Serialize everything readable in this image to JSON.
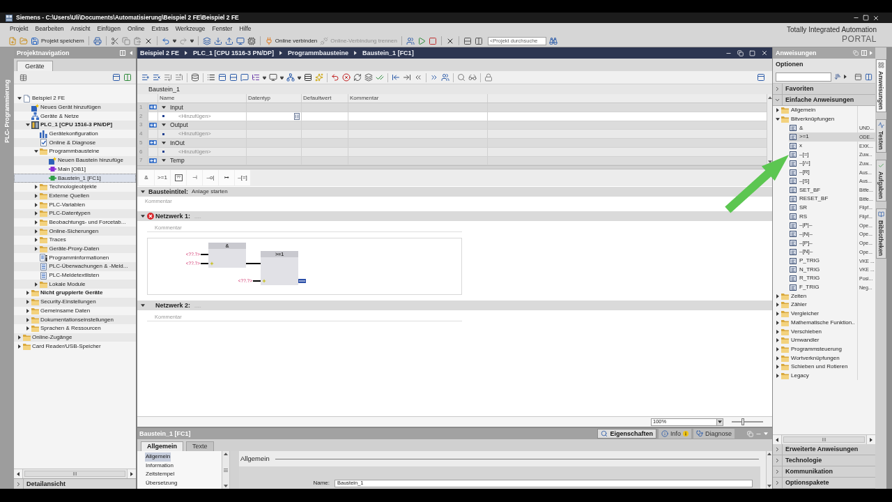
{
  "window": {
    "title": "Siemens - C:\\Users\\Uli\\Documents\\Automatisierung\\Beispiel 2 FE\\Beispiel 2 FE"
  },
  "menu": [
    "Projekt",
    "Bearbeiten",
    "Ansicht",
    "Einfügen",
    "Online",
    "Extras",
    "Werkzeuge",
    "Fenster",
    "Hilfe"
  ],
  "toolbar": {
    "save": {
      "label": "Projekt speichern"
    },
    "connect": {
      "label": "Online verbinden",
      "disabled": false
    },
    "disconnect": {
      "label": "Online-Verbindung trennen",
      "disabled": true
    },
    "search": {
      "placeholder": "<Projekt durchsuche"
    }
  },
  "brand": {
    "line_1": "Totally Integrated Automation",
    "line_2": "PORTAL"
  },
  "portal_strip": {
    "label": "PLC- Programmierung"
  },
  "project_navigation": {
    "title": "Projektnavigation",
    "tabs": [
      {
        "label": "Geräte",
        "selected": true
      }
    ],
    "tree": [
      {
        "label": "Beispiel 2 FE",
        "kind": "project",
        "expanded": true,
        "selected": false,
        "children": [
          {
            "label": "Neues Gerät hinzufügen",
            "kind": "add",
            "selected": false
          },
          {
            "label": "Geräte & Netze",
            "kind": "network",
            "selected": false
          },
          {
            "label": "PLC_1 [CPU 1516-3 PN/DP]",
            "kind": "device",
            "expanded": true,
            "selected": false,
            "children": [
              {
                "label": "Gerätekonfiguration",
                "kind": "config",
                "selected": false
              },
              {
                "label": "Online & Diagnose",
                "kind": "diagnose",
                "selected": false
              },
              {
                "label": "Programmbausteine",
                "kind": "folder",
                "expanded": true,
                "selected": false,
                "children": [
                  {
                    "label": "Neuen Baustein hinzufüge",
                    "kind": "add",
                    "selected": false
                  },
                  {
                    "label": "Main [OB1]",
                    "kind": "block",
                    "color": "#8b2fd6",
                    "selected": false
                  },
                  {
                    "label": "Baustein_1 [FC1]",
                    "kind": "block",
                    "color": "#2f9e46",
                    "selected": true
                  }
                ]
              },
              {
                "label": "Technologieobjekte",
                "kind": "folder",
                "expanded": false,
                "selected": false
              },
              {
                "label": "Externe Quellen",
                "kind": "folder",
                "expanded": false,
                "selected": false
              },
              {
                "label": "PLC-Variablen",
                "kind": "folder",
                "expanded": false,
                "selected": false
              },
              {
                "label": "PLC-Datentypen",
                "kind": "folder",
                "expanded": false,
                "selected": false
              },
              {
                "label": "Beobachtungs- und Forcetab...",
                "kind": "folder",
                "expanded": false,
                "selected": false
              },
              {
                "label": "Online-Sicherungen",
                "kind": "folder",
                "expanded": false,
                "selected": false
              },
              {
                "label": "Traces",
                "kind": "folder",
                "expanded": false,
                "selected": false
              },
              {
                "label": "Geräte-Proxy-Daten",
                "kind": "folder",
                "expanded": false,
                "selected": false
              },
              {
                "label": "Programminformationen",
                "kind": "info",
                "selected": false
              },
              {
                "label": "PLC-Überwachungen & -Meld...",
                "kind": "list",
                "selected": false
              },
              {
                "label": "PLC-Meldetextlisten",
                "kind": "list",
                "selected": false
              },
              {
                "label": "Lokale Module",
                "kind": "folder",
                "expanded": false,
                "selected": false
              }
            ]
          },
          {
            "label": "Nicht gruppierte Geräte",
            "kind": "device-folder",
            "expanded": false,
            "selected": false
          },
          {
            "label": "Security-Einstellungen",
            "kind": "folder",
            "expanded": false,
            "selected": false
          },
          {
            "label": "Gemeinsame Daten",
            "kind": "folder",
            "expanded": false,
            "selected": false
          },
          {
            "label": "Dokumentationseinstellungen",
            "kind": "folder",
            "expanded": false,
            "selected": false
          },
          {
            "label": "Sprachen & Ressourcen",
            "kind": "folder",
            "expanded": false,
            "selected": false
          }
        ]
      },
      {
        "label": "Online-Zugänge",
        "kind": "folder",
        "expanded": false,
        "selected": false
      },
      {
        "label": "Card Reader/USB-Speicher",
        "kind": "folder",
        "expanded": false,
        "selected": false
      }
    ],
    "detail_view": {
      "label": "Detailansicht",
      "expanded": false
    }
  },
  "editor": {
    "breadcrumb": [
      "Beispiel 2 FE",
      "PLC_1 [CPU 1516-3 PN/DP]",
      "Programmbausteine",
      "Baustein_1 [FC1]"
    ],
    "block_name": "Baustein_1",
    "interface": {
      "columns": [
        "Name",
        "Datentyp",
        "Defaultwert",
        "Kommentar"
      ],
      "rows": [
        {
          "number": "1",
          "kind": "section",
          "name": "Input",
          "expanded": true,
          "selected": false
        },
        {
          "number": "2",
          "kind": "add",
          "name": "<Hinzufügen>",
          "selected": true
        },
        {
          "number": "3",
          "kind": "section",
          "name": "Output",
          "expanded": true,
          "selected": false
        },
        {
          "number": "4",
          "kind": "add",
          "name": "<Hinzufügen>",
          "selected": false
        },
        {
          "number": "5",
          "kind": "section",
          "name": "InOut",
          "expanded": true,
          "selected": false
        },
        {
          "number": "6",
          "kind": "add",
          "name": "<Hinzufügen>",
          "selected": false
        },
        {
          "number": "7",
          "kind": "section",
          "name": "Temp",
          "expanded": true,
          "selected": false
        }
      ]
    },
    "lad_toolbar": [
      {
        "kind": "text",
        "label": "&"
      },
      {
        "kind": "text",
        "label": ">=1"
      },
      {
        "kind": "box",
        "label": "??"
      },
      {
        "kind": "text",
        "label": "⊣"
      },
      {
        "kind": "text",
        "label": "–o|"
      },
      {
        "kind": "text",
        "label": "↦"
      },
      {
        "kind": "text",
        "label": "–[=]"
      }
    ],
    "block_title": {
      "label": "Bausteintitel:",
      "value": "Anlage starten",
      "expanded": true,
      "comment": {
        "placeholder": "Kommentar"
      }
    },
    "networks": [
      {
        "label": "Netzwerk 1:",
        "title": ".....",
        "error": true,
        "expanded": true,
        "comment": {
          "placeholder": "Kommentar"
        },
        "diagram": {
          "gates": [
            {
              "label": "&",
              "inputs": [
                "<??.?>",
                "<??.?>"
              ]
            },
            {
              "label": ">=1",
              "inputs": [
                "<??.?>"
              ]
            }
          ]
        }
      },
      {
        "label": "Netzwerk 2:",
        "title": ".....",
        "error": false,
        "expanded": true,
        "comment": {
          "placeholder": "Kommentar"
        }
      }
    ],
    "zoom": {
      "value": "100%",
      "level": 0.35
    }
  },
  "inspector": {
    "title": "Baustein_1 [FC1]",
    "tabs": [
      {
        "label": "Eigenschaften",
        "kind": "properties",
        "selected": true,
        "notice": false
      },
      {
        "label": "Info",
        "kind": "info",
        "selected": false,
        "notice": true
      },
      {
        "label": "Diagnose",
        "kind": "diagnostics",
        "selected": false,
        "notice": false
      }
    ],
    "subtabs": [
      {
        "label": "Allgemein",
        "selected": true
      },
      {
        "label": "Texte",
        "selected": false
      }
    ],
    "nav": [
      {
        "label": "Allgemein",
        "selected": true
      },
      {
        "label": "Information",
        "selected": false
      },
      {
        "label": "Zeitstempel",
        "selected": false
      },
      {
        "label": "Übersetzung",
        "selected": false
      }
    ],
    "section_title": "Allgemein",
    "fields": [
      {
        "label": "Name:",
        "value": "Baustein_1"
      }
    ]
  },
  "instructions": {
    "title": "Anweisungen",
    "options_label": "Optionen",
    "sections": [
      {
        "label": "Favoriten",
        "expanded": false
      },
      {
        "label": "Einfache Anweisungen",
        "expanded": true,
        "tree": [
          {
            "label": "Allgemein",
            "kind": "folder",
            "expanded": false,
            "selected": false
          },
          {
            "label": "Bitverknüpfungen",
            "kind": "folder",
            "expanded": true,
            "selected": false,
            "children": [
              {
                "label": "&",
                "description": "UND...",
                "kind": "instruction",
                "selected": false
              },
              {
                "label": ">=1",
                "description": "ODE...",
                "kind": "instruction",
                "selected": true
              },
              {
                "label": "x",
                "description": "EXK...",
                "kind": "instruction",
                "selected": false
              },
              {
                "label": "–[=]",
                "description": "Zuw...",
                "kind": "instruction",
                "selected": false
              },
              {
                "label": "–[/=]",
                "description": "Zuw...",
                "kind": "instruction",
                "selected": false
              },
              {
                "label": "–[R]",
                "description": "Aus...",
                "kind": "instruction",
                "selected": false
              },
              {
                "label": "–[S]",
                "description": "Aus...",
                "kind": "instruction",
                "selected": false
              },
              {
                "label": "SET_BF",
                "description": "Bitfe...",
                "kind": "instruction",
                "selected": false
              },
              {
                "label": "RESET_BF",
                "description": "Bitfe...",
                "kind": "instruction",
                "selected": false
              },
              {
                "label": "SR",
                "description": "Flipf...",
                "kind": "instruction",
                "selected": false
              },
              {
                "label": "RS",
                "description": "Flipf...",
                "kind": "instruction",
                "selected": false
              },
              {
                "label": "–|P|–",
                "description": "Ope...",
                "kind": "instruction",
                "selected": false
              },
              {
                "label": "–|N|–",
                "description": "Ope...",
                "kind": "instruction",
                "selected": false
              },
              {
                "label": "–[P]–",
                "description": "Ope...",
                "kind": "instruction",
                "selected": false
              },
              {
                "label": "–[N]–",
                "description": "Ope...",
                "kind": "instruction",
                "selected": false
              },
              {
                "label": "P_TRIG",
                "description": "VKE ...",
                "kind": "instruction",
                "selected": false
              },
              {
                "label": "N_TRIG",
                "description": "VKE ...",
                "kind": "instruction",
                "selected": false
              },
              {
                "label": "R_TRIG",
                "description": "Posi...",
                "kind": "instruction",
                "selected": false
              },
              {
                "label": "F_TRIG",
                "description": "Neg...",
                "kind": "instruction",
                "selected": false
              }
            ]
          },
          {
            "label": "Zeiten",
            "kind": "folder",
            "expanded": false,
            "selected": false
          },
          {
            "label": "Zähler",
            "kind": "folder",
            "expanded": false,
            "selected": false
          },
          {
            "label": "Vergleicher",
            "kind": "folder",
            "expanded": false,
            "selected": false
          },
          {
            "label": "Mathematische Funktion..",
            "kind": "folder",
            "expanded": false,
            "selected": false
          },
          {
            "label": "Verschieben",
            "kind": "folder",
            "expanded": false,
            "selected": false
          },
          {
            "label": "Umwandler",
            "kind": "folder",
            "expanded": false,
            "selected": false
          },
          {
            "label": "Programmsteuerung",
            "kind": "folder",
            "expanded": false,
            "selected": false
          },
          {
            "label": "Wortverknüpfungen",
            "kind": "folder",
            "expanded": false,
            "selected": false
          },
          {
            "label": "Schieben und Rotieren",
            "kind": "folder",
            "expanded": false,
            "selected": false
          },
          {
            "label": "Legacy",
            "kind": "folder",
            "expanded": false,
            "selected": false
          }
        ]
      },
      {
        "label": "Erweiterte Anweisungen",
        "expanded": false
      },
      {
        "label": "Technologie",
        "expanded": false
      },
      {
        "label": "Kommunikation",
        "expanded": false
      },
      {
        "label": "Optionspakete",
        "expanded": false
      }
    ]
  },
  "side_tabs": [
    {
      "label": "Anweisungen",
      "kind": "instructions",
      "selected": true
    },
    {
      "label": "Testen",
      "kind": "testing",
      "selected": false
    },
    {
      "label": "Aufgaben",
      "kind": "tasks",
      "selected": false
    },
    {
      "label": "Bibliotheken",
      "kind": "libraries",
      "selected": false
    }
  ]
}
